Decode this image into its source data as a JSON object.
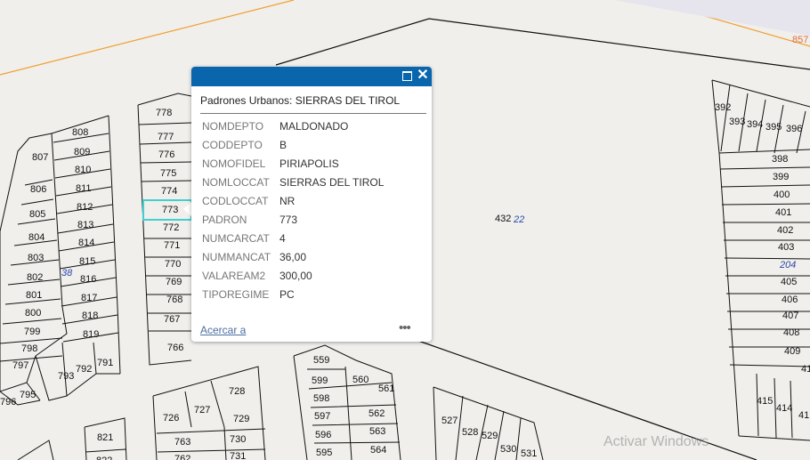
{
  "map": {
    "background_color": "#f0efec",
    "highlight_color": "#40d0d0",
    "road_color": "#f0a030",
    "parcel_labels": [
      "808",
      "809",
      "810",
      "811",
      "812",
      "813",
      "814",
      "815",
      "816",
      "817",
      "818",
      "819",
      "807",
      "806",
      "805",
      "804",
      "803",
      "802",
      "801",
      "800",
      "799",
      "798",
      "797",
      "796",
      "795",
      "793",
      "792",
      "791",
      "778",
      "777",
      "776",
      "775",
      "774",
      "773",
      "772",
      "771",
      "770",
      "769",
      "768",
      "767",
      "766",
      "392",
      "393",
      "394",
      "395",
      "396",
      "398",
      "399",
      "400",
      "401",
      "402",
      "403",
      "405",
      "406",
      "407",
      "408",
      "409",
      "41",
      "415",
      "414",
      "41",
      "559",
      "599",
      "560",
      "561",
      "598",
      "597",
      "562",
      "596",
      "563",
      "595",
      "564",
      "728",
      "726",
      "727",
      "729",
      "763",
      "730",
      "731",
      "762",
      "821",
      "822",
      "527",
      "528",
      "529",
      "530",
      "531",
      "432"
    ],
    "blue_labels": [
      "38",
      "22",
      "204"
    ],
    "orange_labels": [
      "857"
    ]
  },
  "popup": {
    "title": "Padrones Urbanos: SIERRAS DEL TIROL",
    "header_color": "#0966ad",
    "attributes": [
      {
        "key": "NOMDEPTO",
        "value": "MALDONADO"
      },
      {
        "key": "CODDEPTO",
        "value": "B"
      },
      {
        "key": "NOMOFIDEL",
        "value": "PIRIAPOLIS"
      },
      {
        "key": "NOMLOCCAT",
        "value": "SIERRAS DEL TIROL"
      },
      {
        "key": "CODLOCCAT",
        "value": "NR"
      },
      {
        "key": "PADRON",
        "value": "773"
      },
      {
        "key": "NUMCARCAT",
        "value": "4"
      },
      {
        "key": "NUMMANCAT",
        "value": "36,00"
      },
      {
        "key": "VALAREAM2",
        "value": "300,00"
      },
      {
        "key": "TIPOREGIME",
        "value": "PC"
      }
    ],
    "zoom_link": "Acercar a",
    "more_glyph": "•••",
    "close_glyph": "✕",
    "maximize_icon": "maximize-icon"
  },
  "watermark": "Activar Windows"
}
